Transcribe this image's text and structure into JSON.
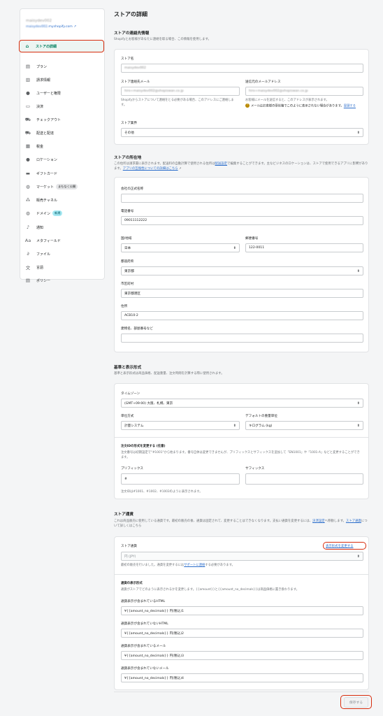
{
  "sidebar": {
    "store_name": "maisydev002",
    "store_url_prefix": "maisydev002",
    "store_url_suffix": ".myshopify.com",
    "items": [
      {
        "label": "ストアの詳細",
        "icon": "store-icon"
      },
      {
        "label": "プラン",
        "icon": "plan-icon"
      },
      {
        "label": "請求情報",
        "icon": "billing-icon"
      },
      {
        "label": "ユーザーと権限",
        "icon": "users-icon"
      },
      {
        "label": "決済",
        "icon": "payments-icon"
      },
      {
        "label": "チェックアウト",
        "icon": "cart-icon"
      },
      {
        "label": "配送と配達",
        "icon": "shipping-icon"
      },
      {
        "label": "税金",
        "icon": "tax-icon"
      },
      {
        "label": "ロケーション",
        "icon": "location-icon"
      },
      {
        "label": "ギフトカード",
        "icon": "giftcard-icon"
      },
      {
        "label": "マーケット",
        "icon": "globe-icon",
        "badge": "まもなく公開"
      },
      {
        "label": "販売チャネル",
        "icon": "channels-icon"
      },
      {
        "label": "ドメイン",
        "icon": "domain-icon",
        "badge": "新規"
      },
      {
        "label": "通知",
        "icon": "bell-icon"
      },
      {
        "label": "メタフィールド",
        "icon": "metafield-icon"
      },
      {
        "label": "ファイル",
        "icon": "paperclip-icon"
      },
      {
        "label": "言語",
        "icon": "language-icon"
      },
      {
        "label": "ポリシー",
        "icon": "policy-icon"
      }
    ]
  },
  "page": {
    "title": "ストアの詳細"
  },
  "contact": {
    "title": "ストアの連絡先情報",
    "desc": "Shopifyとお客様があなたに連絡を取る場合、この情報を使用します。",
    "store_name_label": "ストア名",
    "store_name_value": "maisydev002",
    "email_label": "ストア連絡先メール",
    "email_value": "hiro+maisydev002@shopiswan.co.jp",
    "email_help": "Shopifyからストアについて連絡をとる必要がある場合、このアドレスにご連絡します。",
    "sender_label": "送信元のメールアドレス",
    "sender_value": "hiro+maisydev002@shopiswan.co.jp",
    "sender_help": "お客様にメールを送信すると、このアドレスが表示されます。",
    "sender_warn": "メールはお客様の受信箱でこのように表示されない場合があります。",
    "sender_warn_link": "冒頭する",
    "industry_label": "ストア業界",
    "industry_value": "その他"
  },
  "address": {
    "title": "ストアの所在地",
    "desc1": "この住所は請求書に表示されます。配送料の自動計算で使用される住所は",
    "desc_link1": "配送設定",
    "desc2": "で編集することができます。主なビジネスのロケーションは、ストアで使用できるアプリに影響があります。",
    "desc_link2": "アプリの互換性についての詳細はこちら",
    "company_label": "会社の正式名称",
    "company_value": "",
    "phone_label": "電話番号",
    "phone_value": "09011112222",
    "country_label": "国/地域",
    "country_value": "日本",
    "zip_label": "郵便番号",
    "zip_value": "122-0011",
    "pref_label": "都道府県",
    "pref_value": "東京都",
    "city_label": "市区町村",
    "city_value": "東京都港区",
    "addr_label": "住所",
    "addr_value": "ACB10-2",
    "building_label": "建物名、部屋番号など",
    "building_value": ""
  },
  "standards": {
    "title": "基準と表示形式",
    "desc": "基準と表示形式は商品価格、配送重量、注文時間を計算する際に使用されます。",
    "tz_label": "タイムゾーン",
    "tz_value": "(GMT+09:00) 大阪、札幌、東京",
    "unit_label": "単位方式",
    "unit_value": "計量システム",
    "weight_label": "デフォルトの重量単位",
    "weight_value": "キログラム (kg)",
    "order_title": "注文IDの形式を変更する (任意)",
    "order_desc": "注文番号は初期設定で\"#1001\"から始まります。番号自体は変更できませんが、プリフィックスとサフィックスを追加して「EN1001」や「1001-A」などと変更することができます。",
    "prefix_label": "プリフィックス",
    "prefix_value": "#",
    "suffix_label": "サフィックス",
    "suffix_value": "",
    "order_help": "注文IDは#1001、#1002、#1003のように表示されます。"
  },
  "currency": {
    "title": "ストア通貨",
    "desc1": "これは商品販売に使用している通貨です。最初の販売の後、通貨は固定されて、変更することはできなくなります。支払い通貨を変更するには、",
    "desc_link1": "決済設定",
    "desc2": "へ移動します。",
    "desc_link2": "ストア通貨",
    "desc3": "について詳しくはこちら",
    "label": "ストア通貨",
    "change_link": "表示形式を変更する",
    "value": "円 (JPY)",
    "help1": "最初の販売を行いました。通貨を変更するには",
    "help_link": "サポートに連絡",
    "help2": "する必要があります。",
    "format_title": "通貨の表示形式",
    "format_desc": "通貨がストアでどのように表示されるかを変更します。{{amount}}と{{amount_no_decimals}}は商品価格に置き換わります。",
    "f1_label": "通貨表示が含まれているHTML",
    "f1_value": "¥{{amount_no_decimals}} 円(税込)1",
    "f2_label": "通貨表示が含まれていないHTML",
    "f2_value": "¥{{amount_no_decimals}} 円(税込)2",
    "f3_label": "通貨表示が含まれているメール",
    "f3_value": "¥{{amount_no_decimals}} 円(税込)3",
    "f4_label": "通貨表示が含まれていないメール",
    "f4_value": "¥{{amount_no_decimals}} 円(税込)4"
  },
  "save_label": "保存する"
}
